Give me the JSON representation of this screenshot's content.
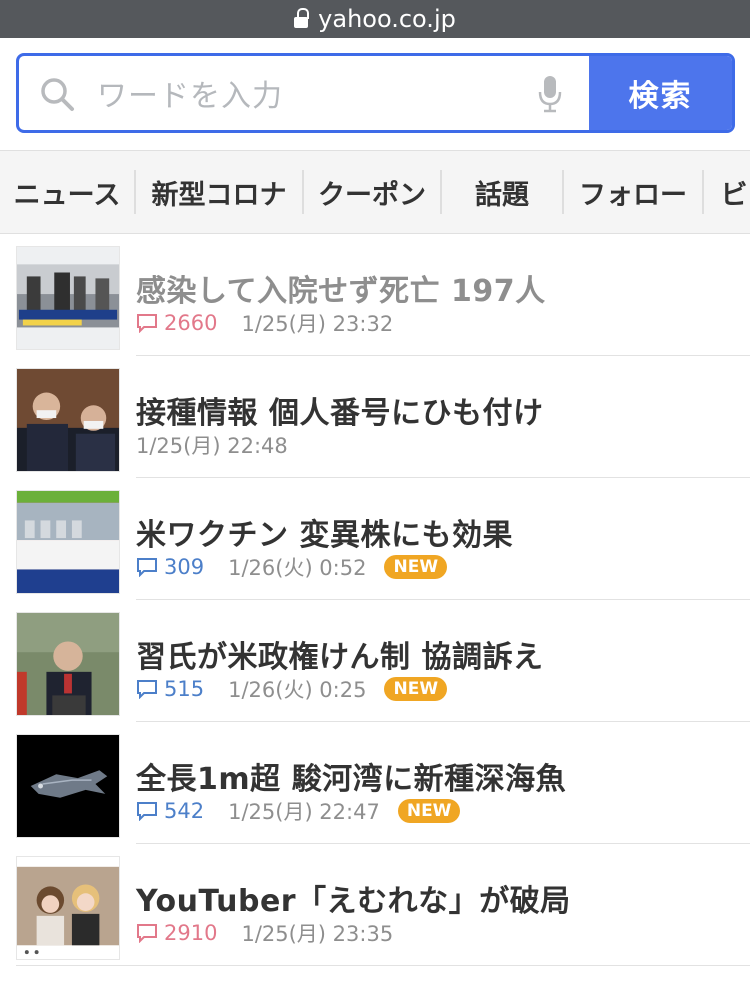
{
  "browser": {
    "url": "yahoo.co.jp"
  },
  "search": {
    "placeholder": "ワードを入力",
    "button_label": "検索"
  },
  "tabs": [
    {
      "label": "ニュース"
    },
    {
      "label": "新型コロナ"
    },
    {
      "label": "クーポン"
    },
    {
      "label": "話題"
    },
    {
      "label": "フォロー"
    },
    {
      "label": "ビ"
    }
  ],
  "news": [
    {
      "title": "感染して入院せず死亡 197人",
      "comments": "2660",
      "datetime": "1/25(月) 23:32",
      "badge": "",
      "visited": true,
      "comment_color": "red"
    },
    {
      "title": "接種情報 個人番号にひも付け",
      "comments": "",
      "datetime": "1/25(月) 22:48",
      "badge": "",
      "visited": false,
      "comment_color": ""
    },
    {
      "title": "米ワクチン 変異株にも効果",
      "comments": "309",
      "datetime": "1/26(火) 0:52",
      "badge": "NEW",
      "visited": false,
      "comment_color": "blue"
    },
    {
      "title": "習氏が米政権けん制 協調訴え",
      "comments": "515",
      "datetime": "1/26(火) 0:25",
      "badge": "NEW",
      "visited": false,
      "comment_color": "blue"
    },
    {
      "title": "全長1m超 駿河湾に新種深海魚",
      "comments": "542",
      "datetime": "1/25(月) 22:47",
      "badge": "NEW",
      "visited": false,
      "comment_color": "blue"
    },
    {
      "title": "YouTuber「えむれな」が破局",
      "comments": "2910",
      "datetime": "1/25(月) 23:35",
      "badge": "",
      "visited": false,
      "comment_color": "red"
    }
  ],
  "colors": {
    "accent": "#4d75ec",
    "new_badge": "#f0a623",
    "comment_blue": "#4c7fc9",
    "comment_red": "#e2788a"
  }
}
